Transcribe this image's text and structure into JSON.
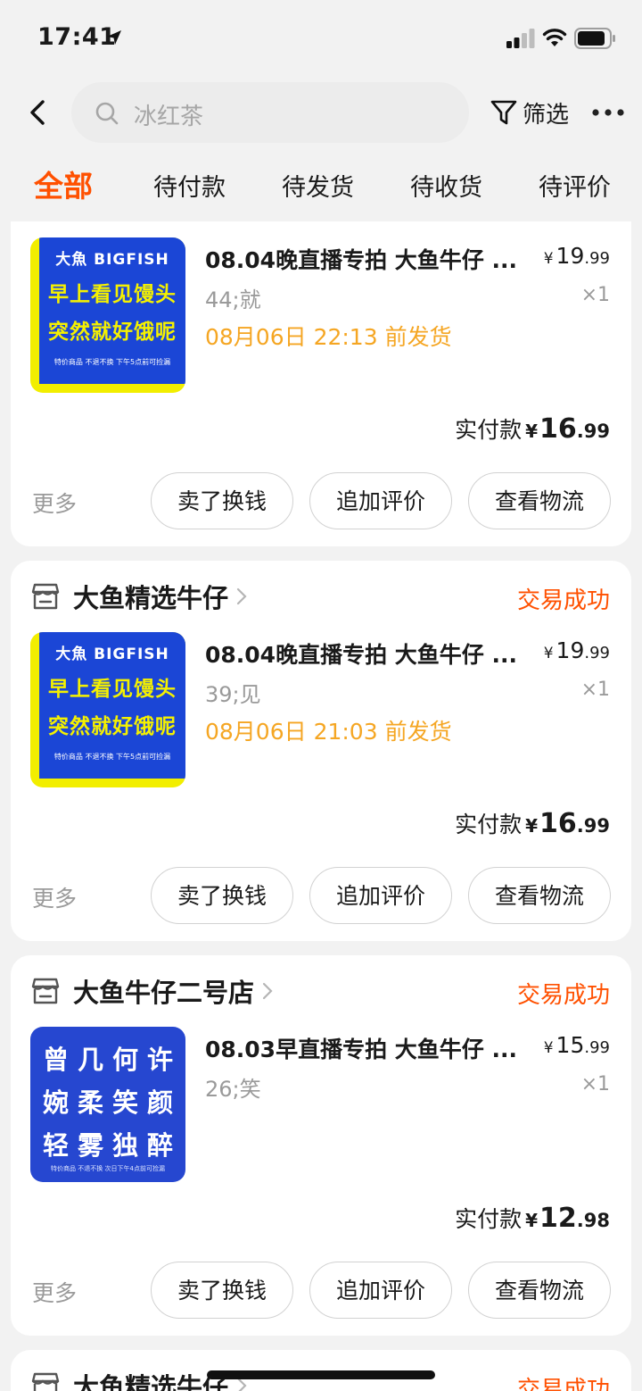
{
  "status_bar": {
    "time": "17:41"
  },
  "search": {
    "placeholder": "冰红茶"
  },
  "header": {
    "filter_label": "筛选"
  },
  "tabs": [
    {
      "label": "全部",
      "active": true
    },
    {
      "label": "待付款"
    },
    {
      "label": "待发货"
    },
    {
      "label": "待收货"
    },
    {
      "label": "待评价"
    }
  ],
  "thumb_bigfish": {
    "brand": "大魚 BIGFISH",
    "line1": "早上看见馒头",
    "line2": "突然就好饿呢",
    "note": "特价商品  不退不换   下午5点前可捡漏"
  },
  "thumb_poem": {
    "row1": "曾几何许",
    "row2": "婉柔笑颜",
    "row3": "轻雾独醉",
    "note": "特价商品  不退不换  次日下午4点前可捡漏"
  },
  "orders": [
    {
      "title": "08.04晚直播专拍 大鱼牛仔 ...",
      "price_currency": "¥",
      "price_int": "19",
      "price_dec": ".99",
      "sku": "44;就",
      "qty": "×1",
      "ship": "08月06日 22:13 前发货",
      "paid_label": "实付款",
      "paid_currency": "¥",
      "paid_int": "16",
      "paid_dec": ".99",
      "more": "更多",
      "buttons": [
        "卖了换钱",
        "追加评价",
        "查看物流"
      ]
    },
    {
      "shop": "大鱼精选牛仔",
      "status": "交易成功",
      "title": "08.04晚直播专拍 大鱼牛仔 ...",
      "price_currency": "¥",
      "price_int": "19",
      "price_dec": ".99",
      "sku": "39;见",
      "qty": "×1",
      "ship": "08月06日 21:03 前发货",
      "paid_label": "实付款",
      "paid_currency": "¥",
      "paid_int": "16",
      "paid_dec": ".99",
      "more": "更多",
      "buttons": [
        "卖了换钱",
        "追加评价",
        "查看物流"
      ]
    },
    {
      "shop": "大鱼牛仔二号店",
      "status": "交易成功",
      "title": "08.03早直播专拍 大鱼牛仔 ...",
      "price_currency": "¥",
      "price_int": "15",
      "price_dec": ".99",
      "sku": "26;笑",
      "qty": "×1",
      "paid_label": "实付款",
      "paid_currency": "¥",
      "paid_int": "12",
      "paid_dec": ".98",
      "more": "更多",
      "buttons": [
        "卖了换钱",
        "追加评价",
        "查看物流"
      ]
    },
    {
      "shop": "大鱼精选牛仔",
      "status": "交易成功"
    }
  ]
}
